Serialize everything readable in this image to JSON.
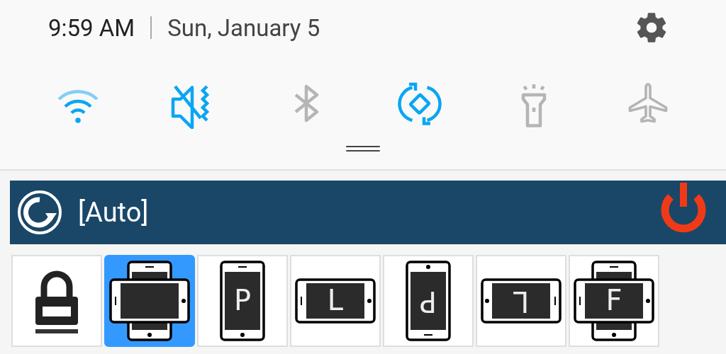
{
  "status": {
    "time": "9:59 AM",
    "date": "Sun, January 5"
  },
  "quick_toggles": [
    {
      "kind": "wifi",
      "on": true
    },
    {
      "kind": "sound",
      "on": true
    },
    {
      "kind": "bluetooth",
      "on": false
    },
    {
      "kind": "rotate",
      "on": true
    },
    {
      "kind": "flashlight",
      "on": false
    },
    {
      "kind": "airplane",
      "on": false
    }
  ],
  "app_bar": {
    "title": "[Auto]",
    "power_on": true
  },
  "modes": [
    {
      "kind": "lock",
      "selected": false
    },
    {
      "kind": "both",
      "selected": true
    },
    {
      "kind": "portrait",
      "letter": "P",
      "reversed": false,
      "selected": false
    },
    {
      "kind": "landscape",
      "letter": "L",
      "reversed": false,
      "selected": false
    },
    {
      "kind": "portrait",
      "letter": "P",
      "reversed": true,
      "selected": false
    },
    {
      "kind": "landscape",
      "letter": "L",
      "reversed": true,
      "selected": false
    },
    {
      "kind": "both",
      "letter": "F",
      "reversed": false,
      "selected": false
    }
  ]
}
